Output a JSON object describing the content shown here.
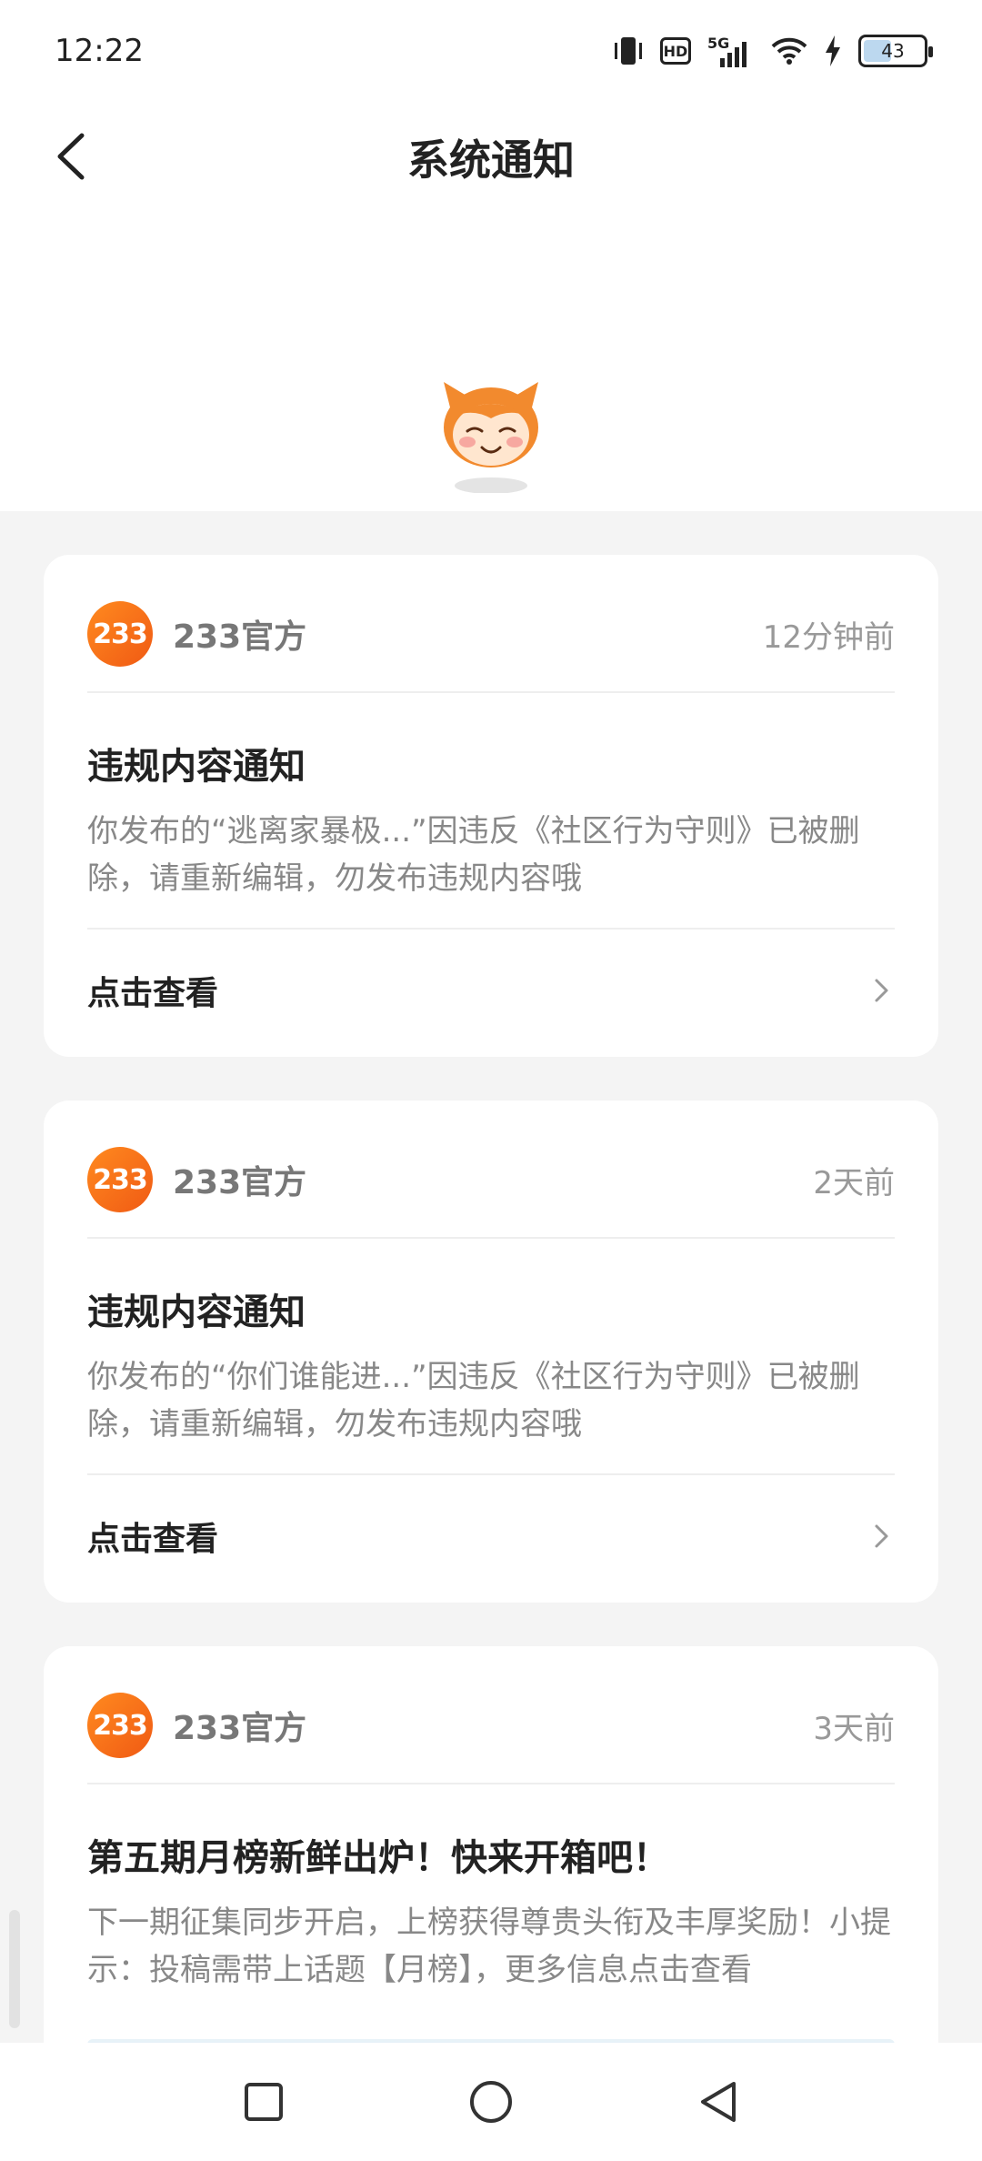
{
  "status_bar": {
    "time": "12:22",
    "network": "5G",
    "hd_label": "HD",
    "battery": "43"
  },
  "header": {
    "title": "系统通知"
  },
  "notifications": [
    {
      "sender": "233官方",
      "logo_text": "233",
      "time": "12分钟前",
      "title": "违规内容通知",
      "body": "你发布的“逃离家暴极...”因违反《社区行为守则》已被删除，请重新编辑，勿发布违规内容哦",
      "action": "点击查看"
    },
    {
      "sender": "233官方",
      "logo_text": "233",
      "time": "2天前",
      "title": "违规内容通知",
      "body": "你发布的“你们谁能进...”因违反《社区行为守则》已被删除，请重新编辑，勿发布违规内容哦",
      "action": "点击查看"
    },
    {
      "sender": "233官方",
      "logo_text": "233",
      "time": "3天前",
      "title": "第五期月榜新鲜出炉！快来开箱吧！",
      "body": "下一期征集同步开启，上榜获得尊贵头衔及丰厚奖励！小提示：投稿需带上话题【月榜】，更多信息点击查看"
    }
  ],
  "colors": {
    "accent": "#f26a1b",
    "background": "#f4f4f4"
  },
  "icons": {
    "back": "back-arrow-icon",
    "chevron": "chevron-right-icon",
    "nav": [
      "square-icon",
      "circle-icon",
      "triangle-back-icon"
    ]
  }
}
